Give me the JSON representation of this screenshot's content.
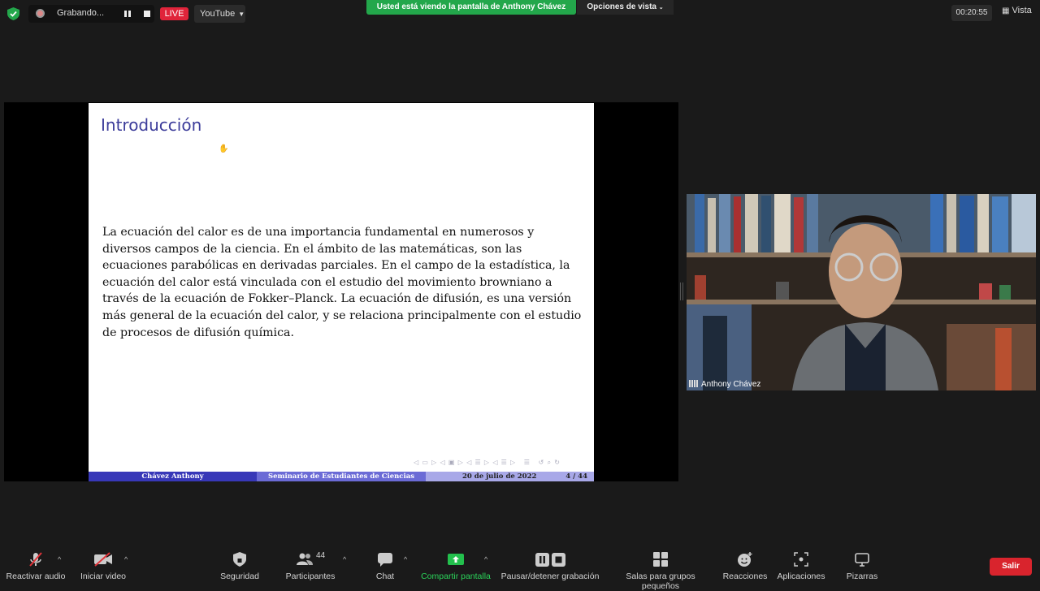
{
  "recording": {
    "label": "Grabando...",
    "live": "LIVE",
    "platform": "YouTube"
  },
  "banner": {
    "sharing": "Usted está viendo la pantalla de Anthony Chávez",
    "view_options": "Opciones de vista"
  },
  "timer": "00:20:55",
  "view_button": "Vista",
  "slide": {
    "title": "Introducción",
    "body": "La ecuación del calor es de una importancia fundamental en numerosos y diversos campos de la ciencia. En el ámbito de las matemáticas, son las ecuaciones parabólicas en derivadas parciales. En el campo de la estadística, la ecuación del calor está vinculada con el estudio del movimiento browniano a través de la ecuación de Fokker–Planck. La ecuación de difusión, es una versión más general de la ecuación del calor, y se relaciona principalmente con el estudio de procesos de difusión química.",
    "footer": {
      "author": "Chávez Anthony",
      "event": "Seminario de Estudiantes de Ciencias",
      "date": "20 de julio de 2022",
      "page": "4 / 44"
    }
  },
  "participant": {
    "name": "Anthony Chávez"
  },
  "toolbar": {
    "audio": "Reactivar audio",
    "video": "Iniciar video",
    "security": "Seguridad",
    "participants": "Participantes",
    "participants_count": "44",
    "chat": "Chat",
    "share": "Compartir pantalla",
    "record": "Pausar/detener grabación",
    "breakout": "Salas para grupos pequeños",
    "reactions": "Reacciones",
    "apps": "Aplicaciones",
    "whiteboards": "Pizarras",
    "leave": "Salir"
  },
  "colors": {
    "share_green": "#23a74b",
    "live_red": "#e0243a",
    "leave_red": "#d9242d",
    "slide_title": "#3c3c9a"
  }
}
